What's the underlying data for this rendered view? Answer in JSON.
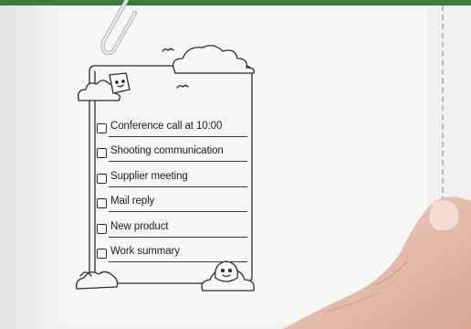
{
  "checklist": {
    "items": [
      {
        "label": "Conference call at 10:00"
      },
      {
        "label": "Shooting communication"
      },
      {
        "label": "Supplier meeting"
      },
      {
        "label": "Mail reply"
      },
      {
        "label": "New product"
      },
      {
        "label": "Work summary"
      }
    ]
  },
  "colors": {
    "top_strip": "#3f7a3c",
    "paper": "#f7f7f6",
    "ink": "#1e1e1e",
    "skin": "#e8c3b2"
  },
  "icons": [
    "paperclip-icon",
    "cloud-icon",
    "bird-icon",
    "cute-flag-icon",
    "cute-face-icon"
  ]
}
